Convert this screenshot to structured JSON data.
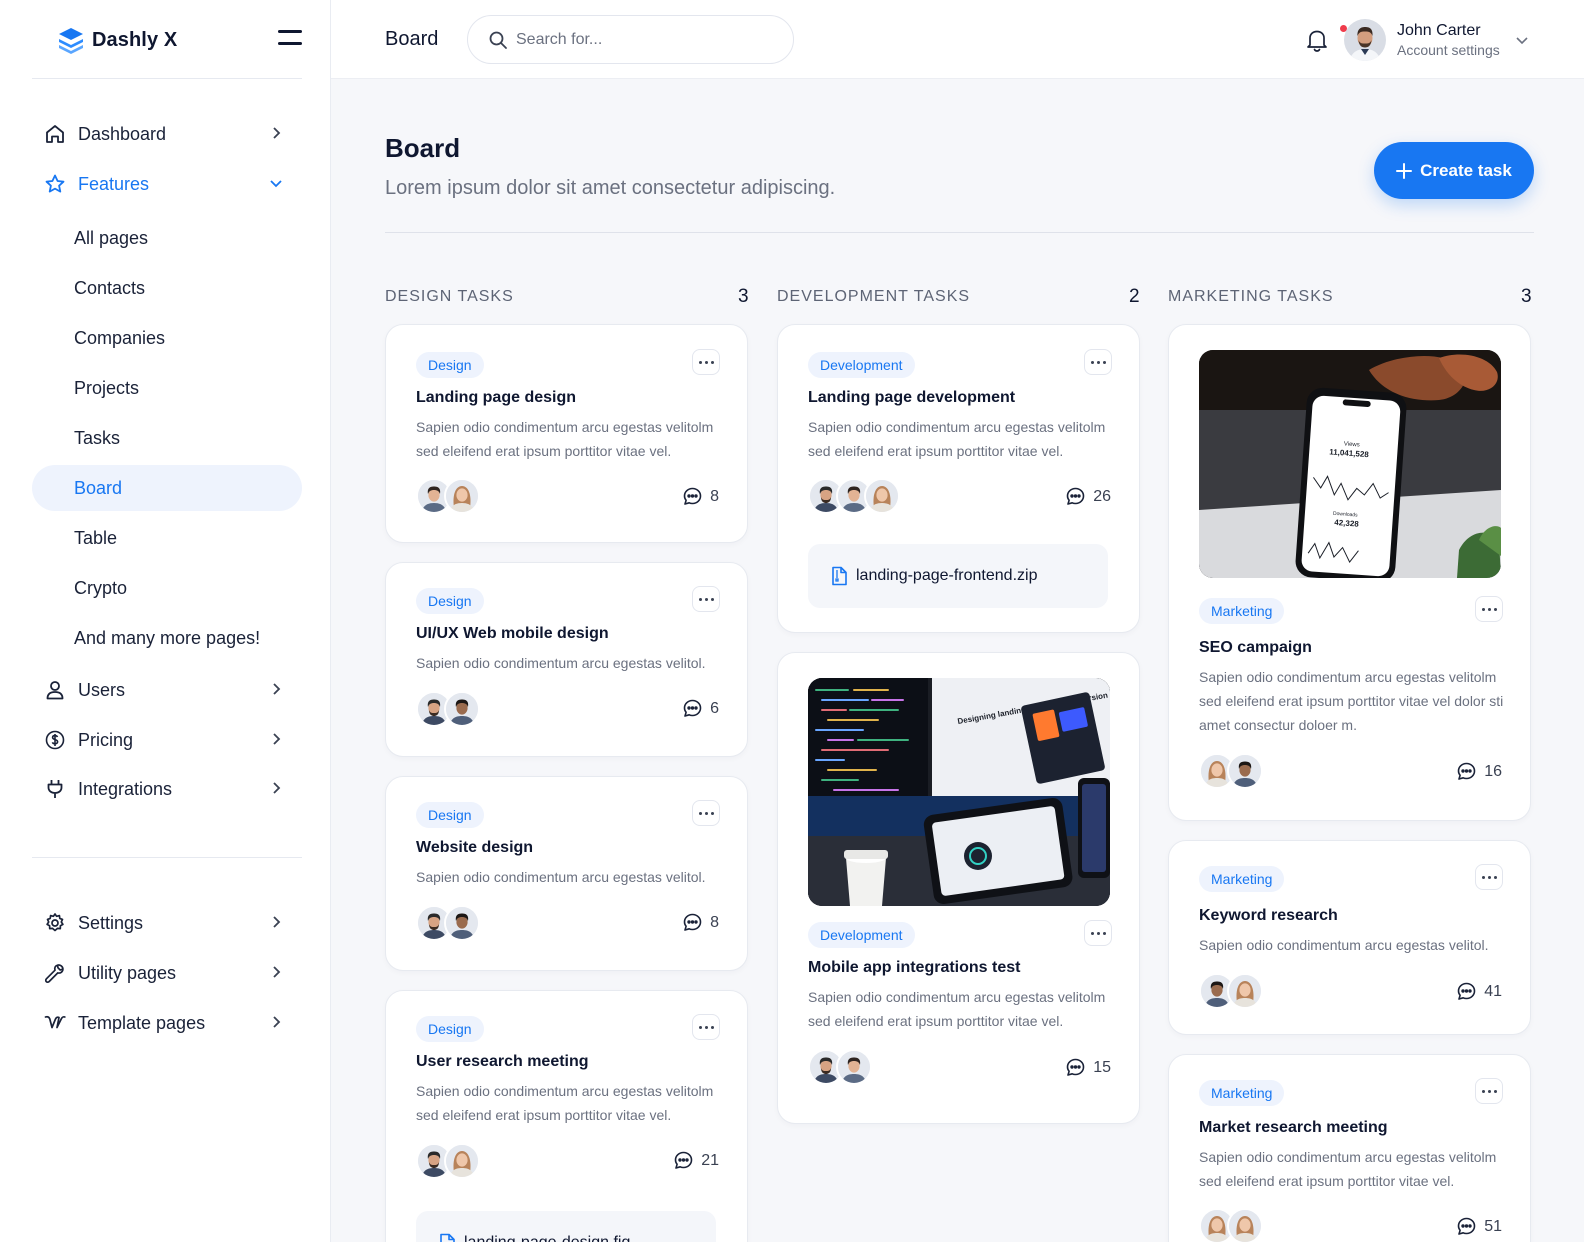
{
  "app": {
    "name": "Dashly X"
  },
  "sidebar": {
    "items": [
      {
        "label": "Dashboard"
      },
      {
        "label": "Features"
      },
      {
        "label": "Users"
      },
      {
        "label": "Pricing"
      },
      {
        "label": "Integrations"
      }
    ],
    "features_sub": [
      "All pages",
      "Contacts",
      "Companies",
      "Projects",
      "Tasks",
      "Board",
      "Table",
      "Crypto",
      "And many more pages!"
    ],
    "bottom_items": [
      {
        "label": "Settings"
      },
      {
        "label": "Utility pages"
      },
      {
        "label": "Template pages"
      }
    ],
    "active_sub": "Board"
  },
  "header": {
    "title": "Board",
    "search_placeholder": "Search for...",
    "user_name": "John Carter",
    "user_sub": "Account settings"
  },
  "page": {
    "title": "Board",
    "subtitle": "Lorem ipsum dolor sit amet consectetur adipiscing.",
    "create_button": "Create task"
  },
  "columns": [
    {
      "title": "DESIGN TASKS",
      "count": "3",
      "cards": [
        {
          "tag": "Design",
          "title": "Landing page design",
          "desc": "Sapien odio condimentum arcu egestas velitolm sed eleifend erat ipsum porttitor vitae vel.",
          "comments": "8"
        },
        {
          "tag": "Design",
          "title": "UI/UX Web mobile design",
          "desc": "Sapien odio condimentum arcu egestas velitol.",
          "comments": "6"
        },
        {
          "tag": "Design",
          "title": "Website design",
          "desc": "Sapien odio condimentum arcu egestas velitol.",
          "comments": "8"
        },
        {
          "tag": "Design",
          "title": "User research meeting",
          "desc": "Sapien odio condimentum arcu egestas velitolm sed eleifend erat ipsum porttitor vitae vel.",
          "comments": "21",
          "file": "landing-page-design.fig"
        }
      ]
    },
    {
      "title": "DEVELOPMENT TASKS",
      "count": "2",
      "cards": [
        {
          "tag": "Development",
          "title": "Landing page development",
          "desc": "Sapien odio condimentum arcu egestas velitolm sed eleifend erat ipsum porttitor vitae vel.",
          "comments": "26",
          "file": "landing-page-frontend.zip"
        },
        {
          "tag": "Development",
          "title": "Mobile app integrations test",
          "desc": "Sapien odio condimentum arcu egestas velitolm sed eleifend erat ipsum porttitor vitae vel.",
          "comments": "15"
        }
      ]
    },
    {
      "title": "MARKETING TASKS",
      "count": "3",
      "cards": [
        {
          "tag": "Marketing",
          "title": "SEO campaign",
          "desc": "Sapien odio condimentum arcu egestas velitolm sed eleifend erat ipsum porttitor vitae vel dolor sti amet consectur doloer m.",
          "comments": "16",
          "phone_views": "11,041,528",
          "phone_downloads": "42,328",
          "phone_views_label": "Views",
          "phone_downloads_label": "Downloads"
        },
        {
          "tag": "Marketing",
          "title": "Keyword research",
          "desc": "Sapien odio condimentum arcu egestas velitol.",
          "comments": "41"
        },
        {
          "tag": "Marketing",
          "title": "Market research meeting",
          "desc": "Sapien odio condimentum arcu egestas velitolm sed eleifend erat ipsum porttitor vitae vel.",
          "comments": "51"
        }
      ]
    }
  ],
  "image_texts": {
    "monitor_headline": "Designing landing pages for conversion"
  },
  "colors": {
    "accent": "#1877f2",
    "text": "#0f1730",
    "muted": "#6b7180",
    "notification": "#ef3b4b"
  }
}
